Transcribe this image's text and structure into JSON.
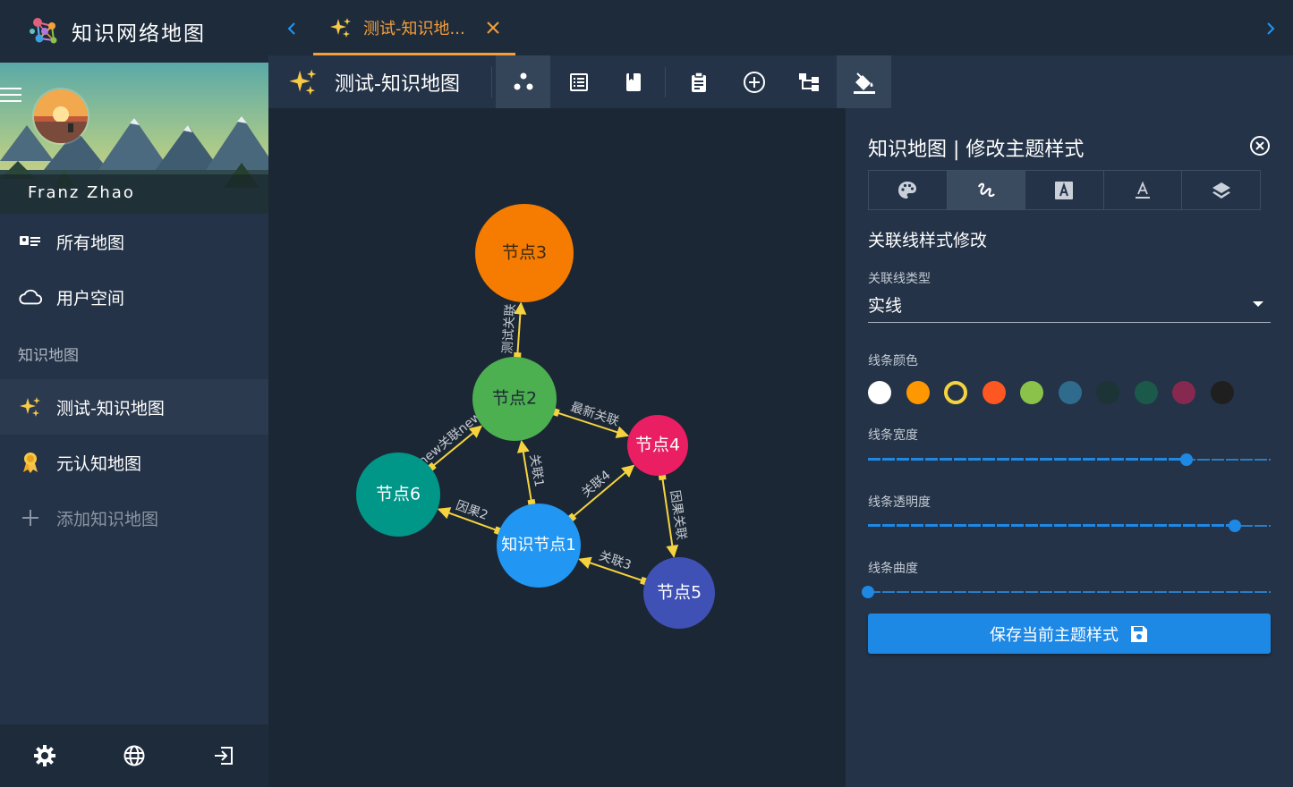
{
  "app": {
    "title": "知识网络地图"
  },
  "user": {
    "name": "Franz Zhao"
  },
  "sidebar": {
    "items": [
      {
        "label": "所有地图"
      },
      {
        "label": "用户空间"
      }
    ],
    "section_label": "知识地图",
    "maps": [
      {
        "label": "测试-知识地图",
        "active": true
      },
      {
        "label": "元认知地图",
        "active": false
      }
    ],
    "add_label": "添加知识地图"
  },
  "tabs": [
    {
      "label": "测试-知识地...",
      "active": true
    }
  ],
  "toolbar": {
    "title": "测试-知识地图",
    "icons": [
      "graph-icon",
      "list-icon",
      "book-icon",
      "clipboard-icon",
      "add-circle-icon",
      "tree-icon",
      "paint-bucket-icon"
    ],
    "selected": [
      "graph-icon",
      "paint-bucket-icon"
    ]
  },
  "graph": {
    "nodes": [
      {
        "id": "n3",
        "label": "节点3",
        "color": "#f57c00"
      },
      {
        "id": "n2",
        "label": "节点2",
        "color": "#4caf50"
      },
      {
        "id": "n4",
        "label": "节点4",
        "color": "#e91e63"
      },
      {
        "id": "n6",
        "label": "节点6",
        "color": "#009688"
      },
      {
        "id": "n1",
        "label": "知识节点1",
        "color": "#2196f3"
      },
      {
        "id": "n5",
        "label": "节点5",
        "color": "#3f51b5"
      }
    ],
    "links": [
      {
        "from": "n2",
        "to": "n3",
        "label": "测试关联"
      },
      {
        "from": "n2",
        "to": "n4",
        "label": "最新关联"
      },
      {
        "from": "n6",
        "to": "n2",
        "label": "new关联new"
      },
      {
        "from": "n1",
        "to": "n2",
        "label": "关联1"
      },
      {
        "from": "n1",
        "to": "n4",
        "label": "关联4"
      },
      {
        "from": "n4",
        "to": "n5",
        "label": "因果关联"
      },
      {
        "from": "n1",
        "to": "n6",
        "label": "因果2"
      },
      {
        "from": "n5",
        "to": "n1",
        "label": "关联3"
      }
    ],
    "link_color": "#f6d33e"
  },
  "panel": {
    "title": "知识地图 | 修改主题样式",
    "tabs": [
      "palette-icon",
      "line-style-icon",
      "text-box-icon",
      "text-format-icon",
      "layers-icon"
    ],
    "selected_tab": "line-style-icon",
    "section_title": "关联线样式修改",
    "line_type": {
      "label": "关联线类型",
      "value": "实线"
    },
    "line_color": {
      "label": "线条颜色",
      "swatches": [
        "#ffffff",
        "#ff9800",
        "#f6d33e",
        "#ff5722",
        "#8bc34a",
        "#2f6b8c",
        "#1c3435",
        "#1b5a4b",
        "#86284f",
        "#1f1f1f"
      ],
      "selected": "#f6d33e"
    },
    "line_width": {
      "label": "线条宽度",
      "value": 0.79
    },
    "line_opacity": {
      "label": "线条透明度",
      "value": 0.91
    },
    "line_curvature": {
      "label": "线条曲度",
      "value": 0.0
    },
    "save_label": "保存当前主题样式"
  }
}
